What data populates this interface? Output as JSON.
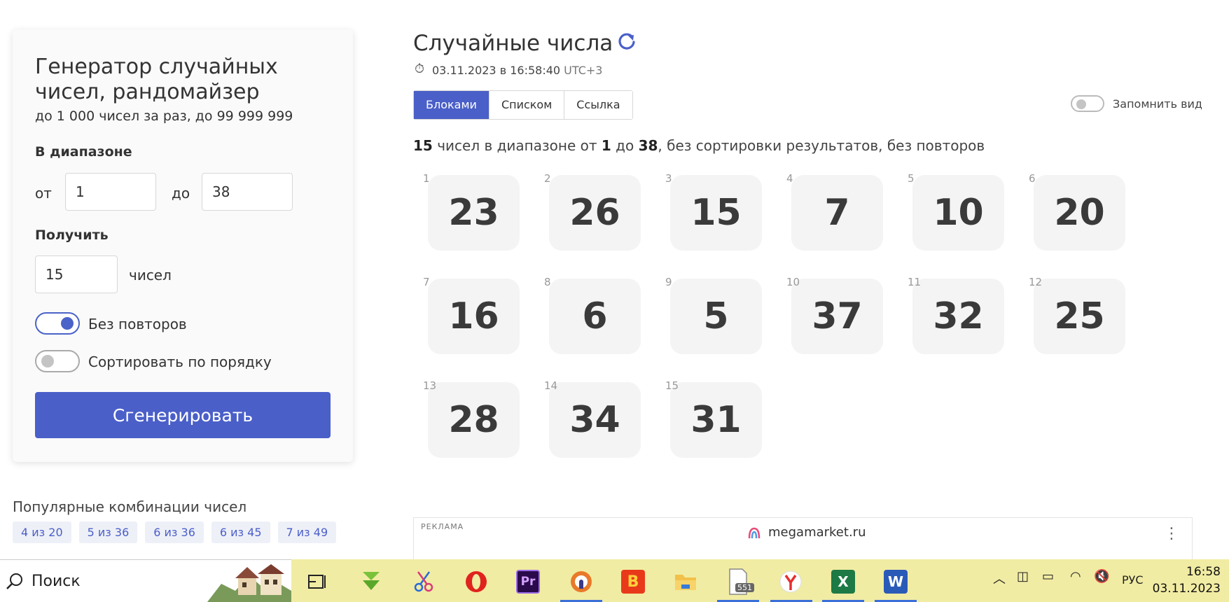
{
  "panel": {
    "title": "Генератор случайных чисел, рандомайзер",
    "subtitle": "до 1 000 чисел за раз, до 99 999 999",
    "range_label": "В диапазоне",
    "from_label": "от",
    "from_value": "1",
    "to_label": "до",
    "to_value": "38",
    "get_label": "Получить",
    "count_value": "15",
    "count_unit": "чисел",
    "no_repeat_label": "Без повторов",
    "no_repeat_on": true,
    "sort_label": "Сортировать по порядку",
    "sort_on": false,
    "generate_label": "Сгенерировать"
  },
  "popular": {
    "title": "Популярные комбинации чисел",
    "tags": [
      "4 из 20",
      "5 из 36",
      "6 из 36",
      "6 из 45",
      "7 из 49"
    ]
  },
  "main": {
    "title": "Случайные числа",
    "timestamp": "03.11.2023 в 16:58:40",
    "timezone": "UTC+3",
    "tabs": [
      "Блоками",
      "Списком",
      "Ссылка"
    ],
    "active_tab": 0,
    "remember_label": "Запомнить вид",
    "summary": {
      "count": "15",
      "text1": " чисел в диапазоне от ",
      "from": "1",
      "text2": " до ",
      "to": "38",
      "text3": ", без сортировки результатов, без повторов"
    },
    "results": [
      23,
      26,
      15,
      7,
      10,
      20,
      16,
      6,
      5,
      37,
      32,
      25,
      28,
      34,
      31
    ]
  },
  "ad": {
    "label": "РЕКЛАМА",
    "brand": "megamarket.ru"
  },
  "taskbar": {
    "search_label": "Поиск",
    "badge": "551",
    "lang": "РУС",
    "time": "16:58",
    "date": "03.11.2023"
  },
  "colors": {
    "accent": "#4a5fc8",
    "taskbar": "#f1eca3"
  }
}
